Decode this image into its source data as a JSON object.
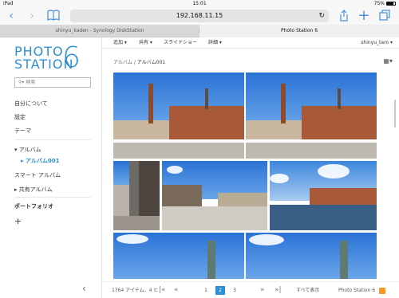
{
  "status": {
    "carrier": "iPad",
    "time": "15:01",
    "battery": "75%"
  },
  "browser": {
    "url": "192.168.11.15",
    "tabs": [
      {
        "label": "shinyu_kaden - Synology DiskStation"
      },
      {
        "label": "Photo Station 6"
      }
    ]
  },
  "logo": {
    "line1": "PHOTO",
    "line2": "STATION",
    "number": "6"
  },
  "sidebar": {
    "search_placeholder": "検索",
    "items": [
      {
        "label": "自分について"
      },
      {
        "label": "設定"
      },
      {
        "label": "テーマ"
      },
      {
        "label": "アルバム"
      },
      {
        "label": "アルバム001"
      },
      {
        "label": "スマート アルバム"
      },
      {
        "label": "共有アルバム"
      },
      {
        "label": "ポートフォリオ"
      }
    ],
    "add_symbol": "+"
  },
  "menu": {
    "items": [
      {
        "label": "追加 ▾"
      },
      {
        "label": "共有 ▾"
      },
      {
        "label": "スライドショー"
      },
      {
        "label": "詳細 ▾"
      }
    ],
    "user": "shinyu_taro ▾"
  },
  "breadcrumb": {
    "root": "アルバム",
    "separator": "/",
    "current": "アルバム001"
  },
  "footer": {
    "count_text": "1764 アイテム、4 ヒ",
    "pages": [
      "1",
      "2",
      "3"
    ],
    "active_page": "2",
    "show_all": "すべて表示",
    "brand": "Photo Station 6"
  },
  "colors": {
    "accent": "#2d8fd5",
    "sky": "#2a72d6",
    "brick": "#a85a38"
  }
}
